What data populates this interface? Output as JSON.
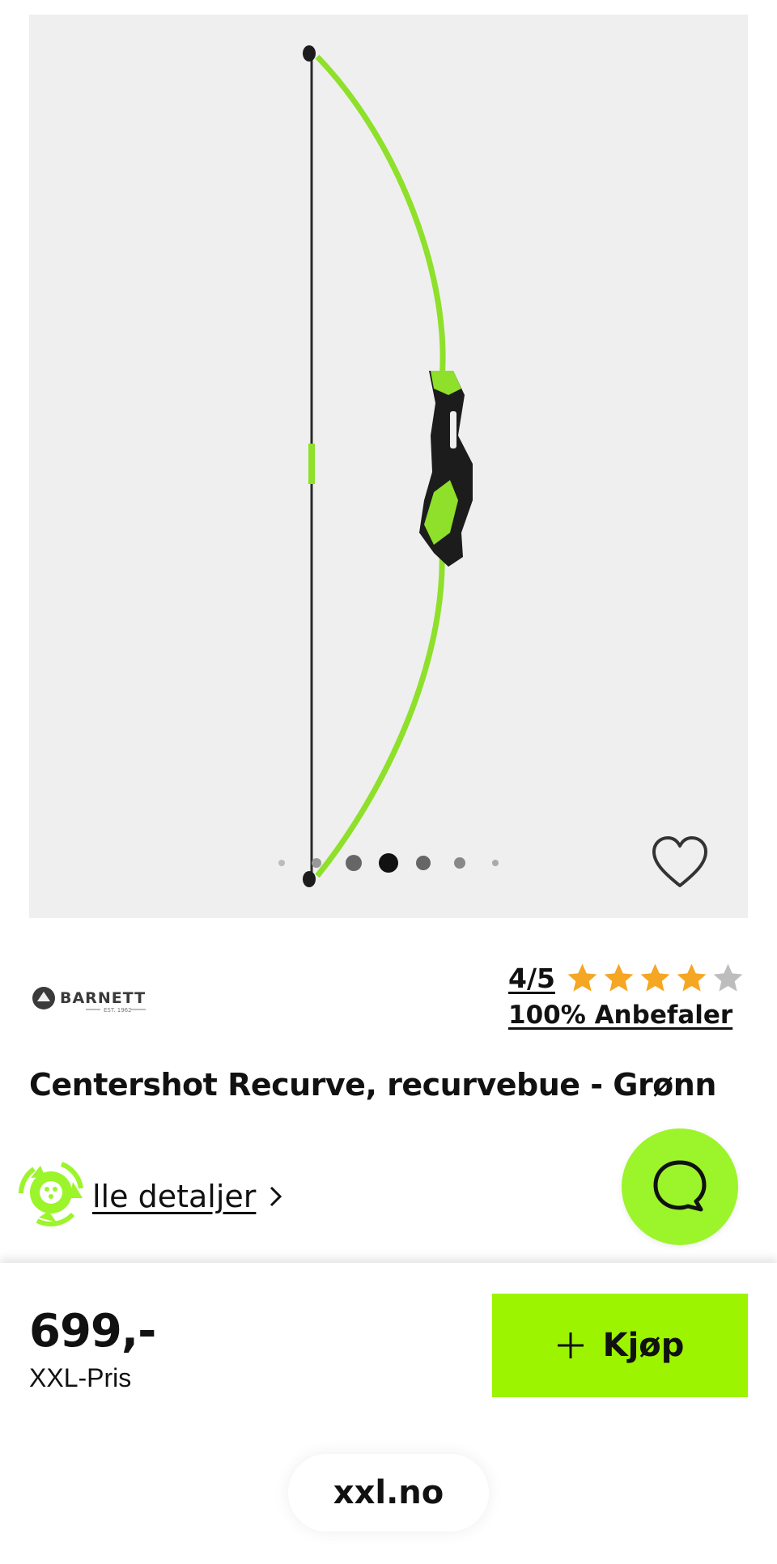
{
  "gallery": {
    "image_alt": "Centershot Recurve bow",
    "slide_count": 7,
    "active_slide": 4
  },
  "favorite": {
    "icon": "heart-outline-icon"
  },
  "brand": {
    "name": "BARNETT",
    "tagline": "EST. 1962"
  },
  "rating": {
    "score_text": "4/5",
    "stars_filled": 4,
    "stars_total": 5,
    "recommend_text": "100% Anbefaler"
  },
  "product": {
    "title": "Centershot Recurve, recurvebue - Grønn"
  },
  "details": {
    "link_text": "lle detaljer"
  },
  "chat": {
    "icon": "chat-bubble-icon"
  },
  "buybar": {
    "price": "699,-",
    "price_label": "XXL-Pris",
    "buy_label": "Kjøp"
  },
  "browser": {
    "url": "xxl.no"
  },
  "colors": {
    "accent_green": "#9cf400",
    "star_gold": "#f5a623",
    "star_empty": "#bdbdbd",
    "gallery_bg": "#efefef"
  }
}
